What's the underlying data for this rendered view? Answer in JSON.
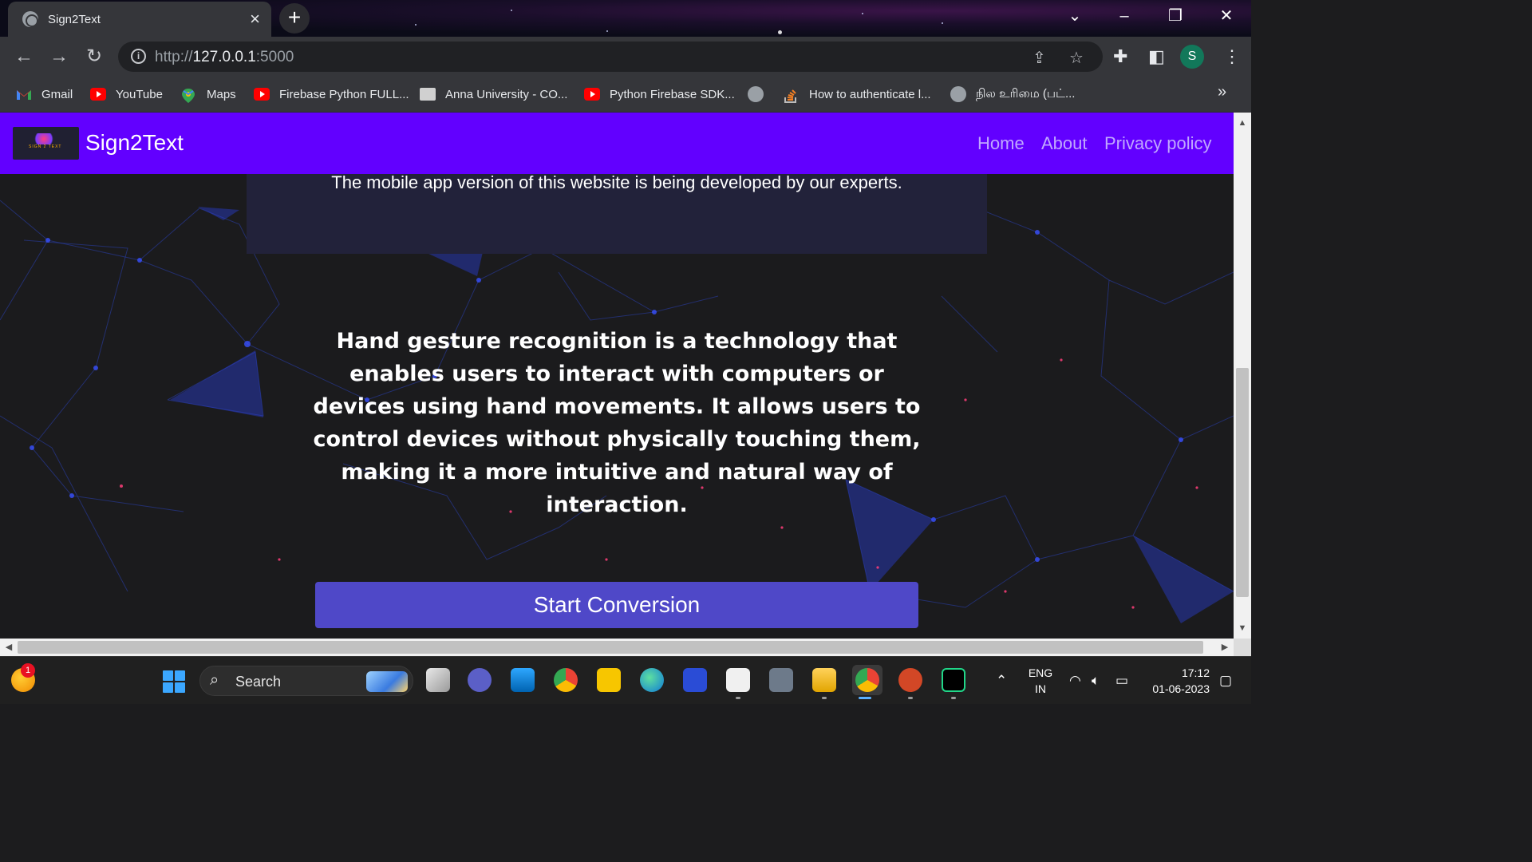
{
  "browser": {
    "tab_title": "Sign2Text",
    "url_prefix": "http://",
    "url_host": "127.0.0.1",
    "url_port": ":5000"
  },
  "bookmarks": [
    {
      "label": "Gmail",
      "icon": "gmail-icon"
    },
    {
      "label": "YouTube",
      "icon": "youtube-icon"
    },
    {
      "label": "Maps",
      "icon": "maps-icon"
    },
    {
      "label": "Firebase Python FULL...",
      "icon": "youtube-icon"
    },
    {
      "label": "Anna University - CO...",
      "icon": "anna-university-icon"
    },
    {
      "label": "Python Firebase SDK...",
      "icon": "youtube-icon"
    },
    {
      "label": "",
      "icon": "globe-icon"
    },
    {
      "label": "How to authenticate l...",
      "icon": "stackoverflow-icon"
    },
    {
      "label": "நில உரிமை (பட்...",
      "icon": "globe-icon"
    }
  ],
  "navbar": {
    "brand": "Sign2Text",
    "links": [
      "Home",
      "About",
      "Privacy policy"
    ]
  },
  "card": {
    "text": "The mobile app version of this website is being developed by our experts."
  },
  "main": {
    "description": "Hand gesture recognition is a technology that enables users to interact with computers or devices using hand movements. It allows users to control devices without physically touching them, making it a more intuitive and natural way of interaction.",
    "cta_label": "Start Conversion"
  },
  "taskbar": {
    "search_label": "Search",
    "notification_count": "1",
    "language": "ENG",
    "region": "IN",
    "time": "17:12",
    "date": "01-06-2023",
    "profile_initial": "S"
  },
  "colors": {
    "navbar": "#6200ff",
    "cta": "#4f48c8",
    "page_bg": "#1b1b1d"
  }
}
